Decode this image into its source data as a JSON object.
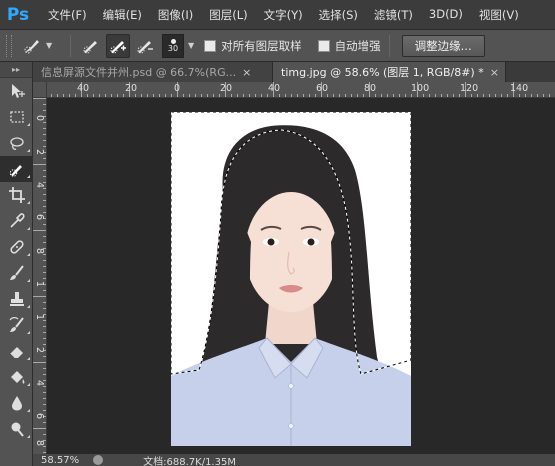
{
  "app": {
    "logo_text": "Ps",
    "menu": [
      "文件(F)",
      "编辑(E)",
      "图像(I)",
      "图层(L)",
      "文字(Y)",
      "选择(S)",
      "滤镜(T)",
      "3D(D)",
      "视图(V)"
    ]
  },
  "options_bar": {
    "brush_size": "30",
    "sample_all_layers_label": "对所有图层取样",
    "sample_all_layers_checked": false,
    "auto_enhance_label": "自动增强",
    "auto_enhance_checked": false,
    "refine_edge_label": "调整边缘..."
  },
  "tabs": [
    {
      "label": "信息屏源文件并州.psd @ 66.7%(RG...",
      "close": "×",
      "active": false
    },
    {
      "label": "timg.jpg @ 58.6% (图层 1, RGB/8#) *",
      "close": "×",
      "active": true
    }
  ],
  "toolbar": {
    "header_glyph": "▸▸",
    "tools": [
      {
        "icon": "move-tool-icon"
      },
      {
        "icon": "rectangular-marquee-icon"
      },
      {
        "icon": "lasso-icon"
      },
      {
        "icon": "quick-selection-icon",
        "active": true
      },
      {
        "icon": "crop-icon"
      },
      {
        "icon": "eyedropper-icon"
      },
      {
        "icon": "healing-brush-icon"
      },
      {
        "icon": "brush-icon"
      },
      {
        "icon": "clone-stamp-icon"
      },
      {
        "icon": "history-brush-icon"
      },
      {
        "icon": "eraser-icon"
      },
      {
        "icon": "paint-bucket-icon"
      },
      {
        "icon": "blur-icon"
      },
      {
        "icon": "dodge-icon"
      }
    ]
  },
  "ruler_top_labels": [
    "40",
    "20",
    "0",
    "20",
    "40",
    "60",
    "80",
    "100",
    "120",
    "140"
  ],
  "ruler_left_labels": [
    "0",
    "2",
    "4",
    "6",
    "8",
    "1",
    "1",
    "2",
    "4",
    "6",
    "8"
  ],
  "colors": {
    "accent": "#31a8ff",
    "panel": "#535353",
    "canvas_bg": "#282828"
  },
  "status": {
    "zoom": "58.57%",
    "doc_info": "文档:688.7K/1.35M"
  }
}
